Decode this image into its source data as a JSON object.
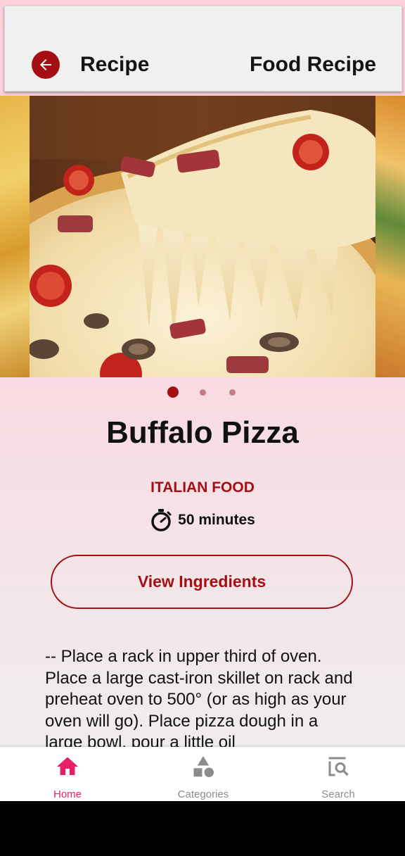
{
  "appbar": {
    "title": "Recipe",
    "right_title": "Food Recipe"
  },
  "carousel": {
    "slide_count": 3,
    "active_index": 0
  },
  "recipe": {
    "name": "Buffalo Pizza",
    "category": "ITALIAN FOOD",
    "time": "50 minutes",
    "view_ingredients_label": "View Ingredients",
    "instructions": "-- Place a rack in upper third of oven. Place a large cast-iron skillet on rack and preheat oven to 500° (or as high as your oven will go). Place pizza dough in a large bowl, pour a little oil"
  },
  "nav": {
    "items": [
      {
        "label": "Home",
        "icon": "home-icon",
        "active": true
      },
      {
        "label": "Categories",
        "icon": "categories-icon",
        "active": false
      },
      {
        "label": "Search",
        "icon": "search-icon",
        "active": false
      }
    ]
  },
  "colors": {
    "accent": "#a50f13",
    "nav_active": "#e81e63",
    "nav_inactive": "#8c8c8c"
  }
}
